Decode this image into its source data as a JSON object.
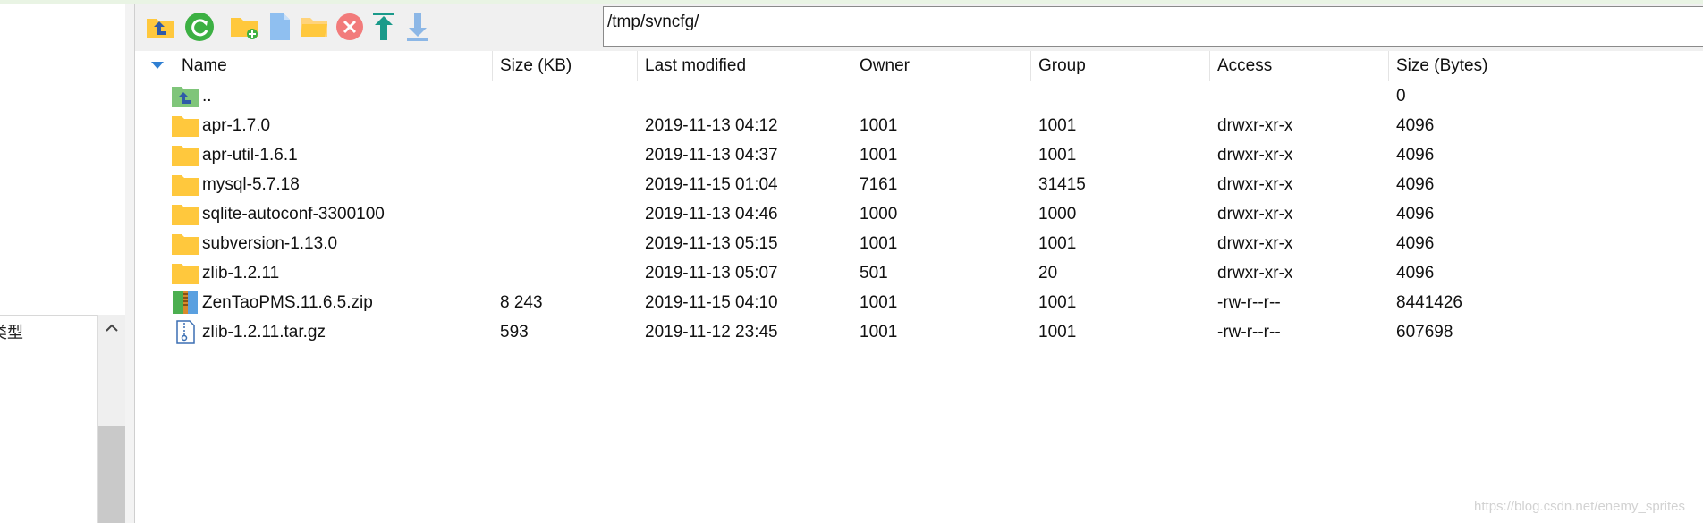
{
  "path": "/tmp/svncfg/",
  "left_pane": {
    "partial_header": "类型"
  },
  "toolbar": {
    "icons": [
      "parent-folder-icon",
      "refresh-icon",
      "new-folder-icon",
      "new-file-icon",
      "open-folder-icon",
      "delete-icon",
      "upload-icon",
      "download-icon"
    ]
  },
  "columns": {
    "name": "Name",
    "size_kb": "Size (KB)",
    "modified": "Last modified",
    "owner": "Owner",
    "group": "Group",
    "access": "Access",
    "size_bytes": "Size (Bytes)"
  },
  "rows": [
    {
      "name": "..",
      "icon": "parent-dir",
      "size_kb": "",
      "modified": "",
      "owner": "",
      "group": "",
      "access": "",
      "size_bytes": "0"
    },
    {
      "name": "apr-1.7.0",
      "icon": "folder",
      "size_kb": "",
      "modified": "2019-11-13 04:12",
      "owner": "1001",
      "group": "1001",
      "access": "drwxr-xr-x",
      "size_bytes": "4096"
    },
    {
      "name": "apr-util-1.6.1",
      "icon": "folder",
      "size_kb": "",
      "modified": "2019-11-13 04:37",
      "owner": "1001",
      "group": "1001",
      "access": "drwxr-xr-x",
      "size_bytes": "4096"
    },
    {
      "name": "mysql-5.7.18",
      "icon": "folder",
      "size_kb": "",
      "modified": "2019-11-15 01:04",
      "owner": "7161",
      "group": "31415",
      "access": "drwxr-xr-x",
      "size_bytes": "4096"
    },
    {
      "name": "sqlite-autoconf-3300100",
      "icon": "folder",
      "size_kb": "",
      "modified": "2019-11-13 04:46",
      "owner": "1000",
      "group": "1000",
      "access": "drwxr-xr-x",
      "size_bytes": "4096"
    },
    {
      "name": "subversion-1.13.0",
      "icon": "folder",
      "size_kb": "",
      "modified": "2019-11-13 05:15",
      "owner": "1001",
      "group": "1001",
      "access": "drwxr-xr-x",
      "size_bytes": "4096"
    },
    {
      "name": "zlib-1.2.11",
      "icon": "folder",
      "size_kb": "",
      "modified": "2019-11-13 05:07",
      "owner": "501",
      "group": "20",
      "access": "drwxr-xr-x",
      "size_bytes": "4096"
    },
    {
      "name": "ZenTaoPMS.11.6.5.zip",
      "icon": "zip",
      "size_kb": "8 243",
      "modified": "2019-11-15 04:10",
      "owner": "1001",
      "group": "1001",
      "access": "-rw-r--r--",
      "size_bytes": "8441426"
    },
    {
      "name": "zlib-1.2.11.tar.gz",
      "icon": "archive",
      "size_kb": "593",
      "modified": "2019-11-12 23:45",
      "owner": "1001",
      "group": "1001",
      "access": "-rw-r--r--",
      "size_bytes": "607698"
    }
  ],
  "watermark": "https://blog.csdn.net/enemy_sprites",
  "colors": {
    "folder": "#ffc83d",
    "accent_blue": "#2f7fd2",
    "green": "#3cb043",
    "delete_red": "#e94b4b",
    "upload_teal": "#1a9a8a"
  }
}
